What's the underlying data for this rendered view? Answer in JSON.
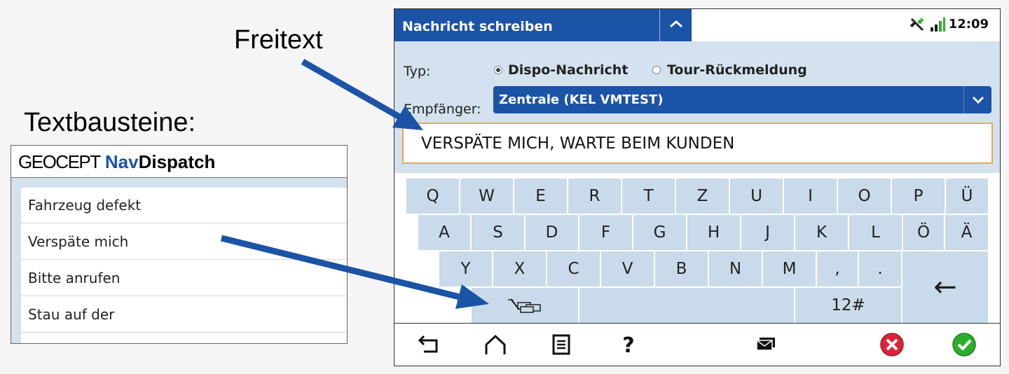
{
  "annotations": {
    "freitext": "Freitext",
    "textbausteine": "Textbausteine:"
  },
  "text_blocks_panel": {
    "logo_geo": "GEOCEPT",
    "logo_nav": "Nav",
    "logo_dispatch": "Dispatch",
    "items": [
      "Fahrzeug defekt",
      "Verspäte mich",
      "Bitte anrufen",
      "Stau auf der"
    ]
  },
  "device": {
    "title": "Nachricht schreiben",
    "time": "12:09",
    "form": {
      "type_label": "Typ:",
      "type_options": [
        {
          "label": "Dispo-Nachricht",
          "selected": true
        },
        {
          "label": "Tour-Rückmeldung",
          "selected": false
        }
      ],
      "recipient_label": "Empfänger:",
      "recipient_value": "Zentrale (KEL VMTEST)",
      "message_value": "VERSPÄTE MICH, WARTE BEIM KUNDEN"
    },
    "keyboard": {
      "row1": [
        "Q",
        "W",
        "E",
        "R",
        "T",
        "Z",
        "U",
        "I",
        "O",
        "P",
        "Ü"
      ],
      "row2": [
        "A",
        "S",
        "D",
        "F",
        "G",
        "H",
        "J",
        "K",
        "L",
        "Ö",
        "Ä"
      ],
      "row3": [
        "Y",
        "X",
        "C",
        "V",
        "B",
        "N",
        "M",
        ",",
        "."
      ],
      "symbols_key": "12#",
      "backspace_key": "←"
    },
    "colors": {
      "accent": "#1b53a6",
      "form_bg": "#d4e1ee",
      "key_bg": "#c9dbea",
      "input_border": "#f0a64a",
      "cancel": "#d9243b",
      "confirm": "#2cae2c"
    }
  }
}
